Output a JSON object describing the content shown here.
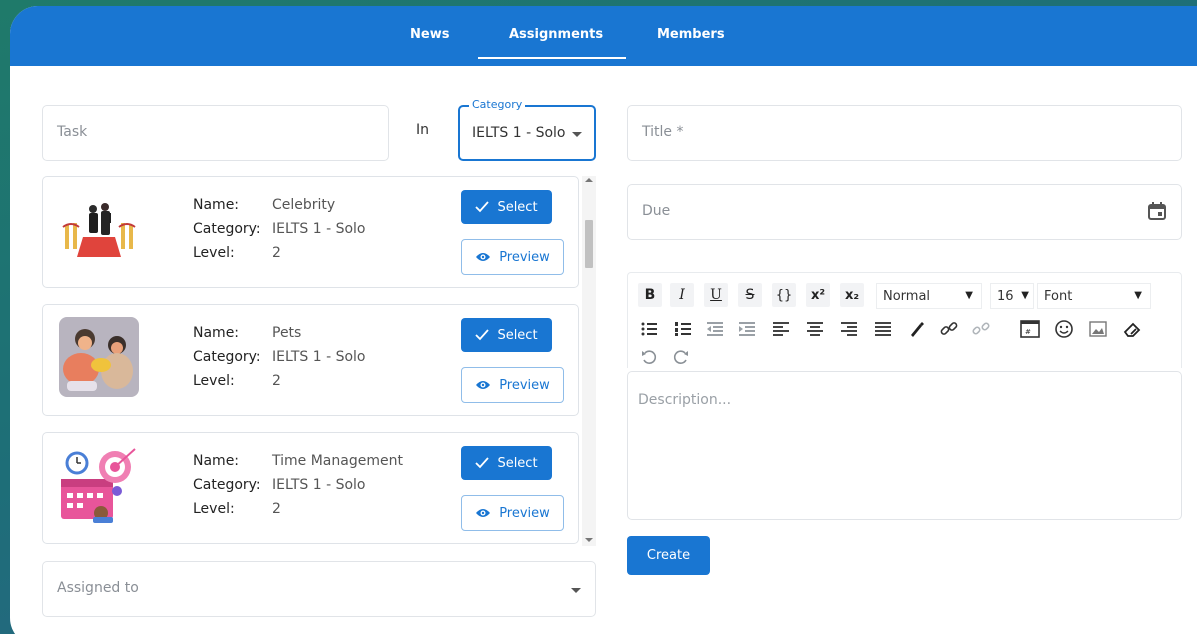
{
  "nav": {
    "tabs": [
      {
        "label": "News"
      },
      {
        "label": "Assignments",
        "active": true
      },
      {
        "label": "Members"
      }
    ]
  },
  "filters": {
    "task_placeholder": "Task",
    "in_label": "In",
    "category_label": "Category",
    "category_value": "IELTS 1 - Solo"
  },
  "assignments": [
    {
      "name_label": "Name:",
      "name": "Celebrity",
      "category_label": "Category:",
      "category": "IELTS 1 - Solo",
      "level_label": "Level:",
      "level": "2",
      "image": "celebrity-illustration"
    },
    {
      "name_label": "Name:",
      "name": "Pets",
      "category_label": "Category:",
      "category": "IELTS 1 - Solo",
      "level_label": "Level:",
      "level": "2",
      "image": "pets-illustration"
    },
    {
      "name_label": "Name:",
      "name": "Time Management",
      "category_label": "Category:",
      "category": "IELTS 1 - Solo",
      "level_label": "Level:",
      "level": "2",
      "image": "time-management-illustration"
    }
  ],
  "buttons": {
    "select": "Select",
    "preview": "Preview",
    "create": "Create"
  },
  "assigned_to_placeholder": "Assigned to",
  "form": {
    "title_placeholder": "Title *",
    "due_placeholder": "Due",
    "description_placeholder": "Description..."
  },
  "editor_toolbar": {
    "bold": "B",
    "italic": "I",
    "underline": "U",
    "strike": "S",
    "code": "{}",
    "superscript": "x²",
    "subscript": "x₂",
    "heading_value": "Normal",
    "size_value": "16",
    "font_value": "Font"
  },
  "colors": {
    "primary": "#1976d2",
    "accent_pink": "#e84a8a"
  }
}
